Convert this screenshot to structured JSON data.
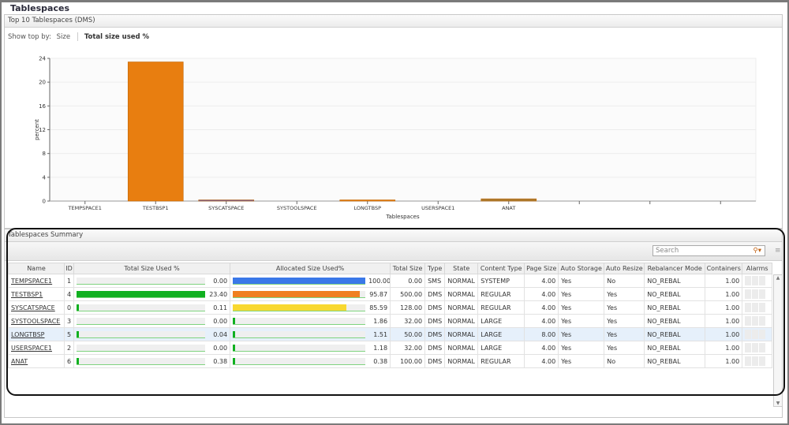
{
  "title": "Tablespaces",
  "top_panel": {
    "title": "Top 10 Tablespaces (DMS)",
    "show_by_label": "Show top by:",
    "options": [
      "Size",
      "Total size used %"
    ],
    "selected": "Total size used %"
  },
  "chart_data": {
    "type": "bar",
    "categories": [
      "TEMPSPACE1",
      "TESTBSP1",
      "SYSCATSPACE",
      "SYSTOOLSPACE",
      "LONGTBSP",
      "USERSPACE1",
      "ANAT",
      "",
      "",
      ""
    ],
    "values": [
      0,
      23.4,
      0.11,
      0,
      0.04,
      0,
      0.38,
      null,
      null,
      null
    ],
    "colors": [
      "#e87e10",
      "#e87e10",
      "#6a5aa8",
      "#e87e10",
      "#e87e10",
      "#e87e10",
      "#a87a30"
    ],
    "xlabel": "Tablespaces",
    "ylabel": "percent",
    "ylim": [
      0,
      24
    ],
    "yticks": [
      0,
      4,
      8,
      12,
      16,
      20,
      24
    ],
    "grid": true
  },
  "summary": {
    "title": "Tablespaces Summary",
    "search_placeholder": "Search",
    "columns": [
      "Name",
      "ID",
      "Total Size Used %",
      "Allocated Size Used%",
      "Total Size",
      "Type",
      "State",
      "Content Type",
      "Page Size",
      "Auto Storage",
      "Auto Resize",
      "Rebalancer Mode",
      "Containers",
      "Alarms"
    ],
    "rows": [
      {
        "name": "TEMPSPACE1",
        "id": "1",
        "used_pct": "0.00",
        "alloc_pct": "100.00",
        "alloc_color": "#3a78e8",
        "total": "0.00",
        "type": "SMS",
        "state": "NORMAL",
        "content": "SYSTEMP",
        "page": "4.00",
        "auto_storage": "Yes",
        "auto_resize": "No",
        "rebal": "NO_REBAL",
        "containers": "1.00"
      },
      {
        "name": "TESTBSP1",
        "id": "4",
        "used_pct": "23.40",
        "alloc_pct": "95.87",
        "alloc_color": "#f08020",
        "total": "500.00",
        "type": "DMS",
        "state": "NORMAL",
        "content": "REGULAR",
        "page": "4.00",
        "auto_storage": "Yes",
        "auto_resize": "Yes",
        "rebal": "NO_REBAL",
        "containers": "1.00"
      },
      {
        "name": "SYSCATSPACE",
        "id": "0",
        "used_pct": "0.11",
        "alloc_pct": "85.59",
        "alloc_color": "#f8d830",
        "total": "128.00",
        "type": "DMS",
        "state": "NORMAL",
        "content": "REGULAR",
        "page": "4.00",
        "auto_storage": "Yes",
        "auto_resize": "Yes",
        "rebal": "NO_REBAL",
        "containers": "1.00"
      },
      {
        "name": "SYSTOOLSPACE",
        "id": "3",
        "used_pct": "0.00",
        "alloc_pct": "1.86",
        "alloc_color": "#10b020",
        "total": "32.00",
        "type": "DMS",
        "state": "NORMAL",
        "content": "LARGE",
        "page": "4.00",
        "auto_storage": "Yes",
        "auto_resize": "Yes",
        "rebal": "NO_REBAL",
        "containers": "1.00"
      },
      {
        "name": "LONGTBSP",
        "id": "5",
        "used_pct": "0.04",
        "alloc_pct": "1.51",
        "alloc_color": "#10b020",
        "total": "50.00",
        "type": "DMS",
        "state": "NORMAL",
        "content": "LARGE",
        "page": "8.00",
        "auto_storage": "Yes",
        "auto_resize": "Yes",
        "rebal": "NO_REBAL",
        "containers": "1.00",
        "selected": true
      },
      {
        "name": "USERSPACE1",
        "id": "2",
        "used_pct": "0.00",
        "alloc_pct": "1.18",
        "alloc_color": "#10b020",
        "total": "32.00",
        "type": "DMS",
        "state": "NORMAL",
        "content": "LARGE",
        "page": "4.00",
        "auto_storage": "Yes",
        "auto_resize": "Yes",
        "rebal": "NO_REBAL",
        "containers": "1.00"
      },
      {
        "name": "ANAT",
        "id": "6",
        "used_pct": "0.38",
        "alloc_pct": "0.38",
        "alloc_color": "#10b020",
        "total": "100.00",
        "type": "DMS",
        "state": "NORMAL",
        "content": "REGULAR",
        "page": "4.00",
        "auto_storage": "Yes",
        "auto_resize": "No",
        "rebal": "NO_REBAL",
        "containers": "1.00"
      }
    ]
  }
}
